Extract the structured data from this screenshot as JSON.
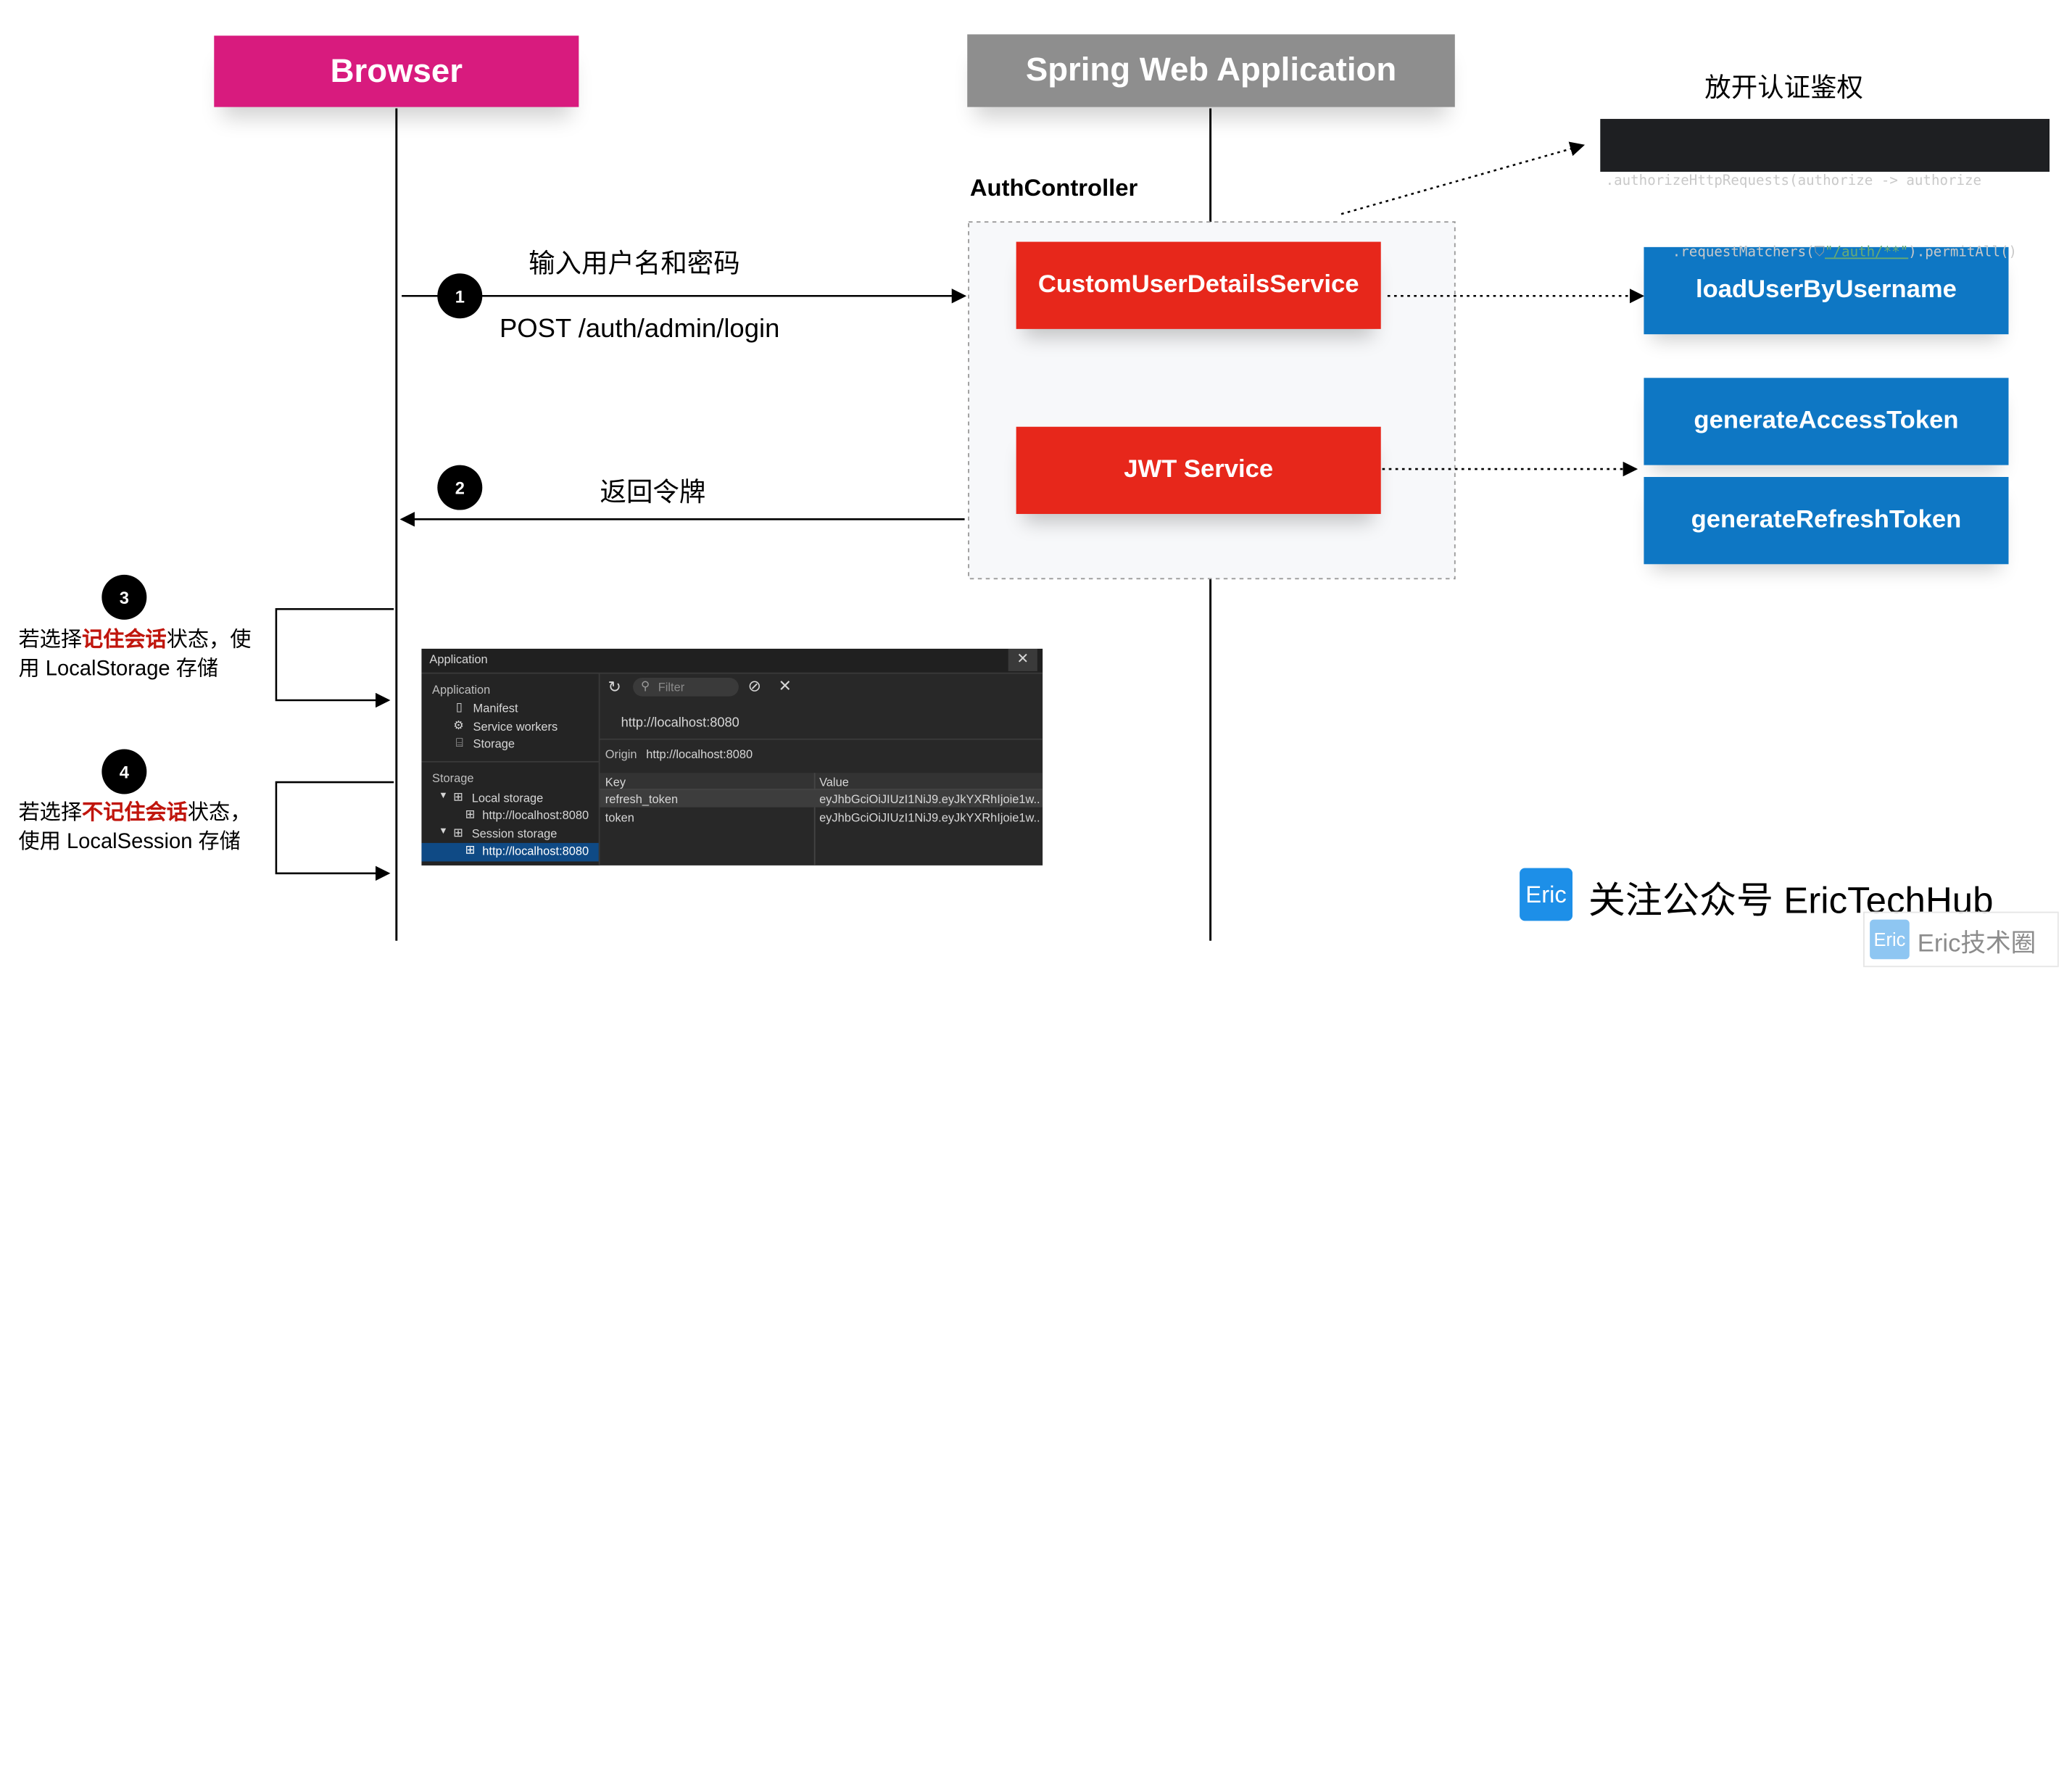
{
  "lanes": {
    "browser": {
      "title": "Browser",
      "color": "#d81b7e"
    },
    "spring": {
      "title": "Spring Web Application",
      "color": "#8e8e8e"
    }
  },
  "controller_title": "AuthController",
  "services": {
    "custom_user_details": "CustomUserDetailsService",
    "jwt_service": "JWT Service"
  },
  "methods": {
    "load_user": "loadUserByUsername",
    "gen_access": "generateAccessToken",
    "gen_refresh": "generateRefreshToken"
  },
  "permit": {
    "title": "放开认证鉴权",
    "code_line1_a": ".authorizeHttpRequests(authorize -> authorize",
    "code_line2_a": "        .requestMatchers(",
    "code_line2_icon": "shield-icon",
    "code_line2_str": "\"/auth/**\"",
    "code_line2_b": ").permitAll()"
  },
  "steps": {
    "s1": {
      "num": "1",
      "label_top": "输入用户名和密码",
      "label_bottom": "POST /auth/admin/login"
    },
    "s2": {
      "num": "2",
      "label": "返回令牌"
    },
    "s3": {
      "num": "3",
      "pre": "若选择",
      "em": "记住会话",
      "post": "状态，使",
      "line2": "用 LocalStorage 存储"
    },
    "s4": {
      "num": "4",
      "pre": "若选择",
      "em": "不记住会话",
      "post": "状态，",
      "line2": "使用 LocalSession 存储"
    }
  },
  "devtools": {
    "window_title": "Application",
    "section_application": "Application",
    "items_application": [
      "Manifest",
      "Service workers",
      "Storage"
    ],
    "section_storage": "Storage",
    "local_storage": "Local storage",
    "local_storage_origin": "http://localhost:8080",
    "session_storage": "Session storage",
    "session_storage_origin": "http://localhost:8080",
    "filter_placeholder": "Filter",
    "origin_url": "http://localhost:8080",
    "origin_label": "Origin",
    "origin_value": "http://localhost:8080",
    "columns": [
      "Key",
      "Value"
    ],
    "rows": [
      {
        "key": "refresh_token",
        "value": "eyJhbGciOiJIUzI1NiJ9.eyJkYXRhIjoie1w..."
      },
      {
        "key": "token",
        "value": "eyJhbGciOiJIUzI1NiJ9.eyJkYXRhIjoie1w..."
      }
    ]
  },
  "footer": {
    "logo_text": "Eric",
    "follow_text": "关注公众号 EricTechHub",
    "watermark_logo": "Eric",
    "watermark_text": "Eric技术圈"
  },
  "colors": {
    "service_red": "#e7271b",
    "method_blue": "#0e77c4",
    "emphasis_red": "#c0150c",
    "logo_blue": "#1d8fe8"
  }
}
